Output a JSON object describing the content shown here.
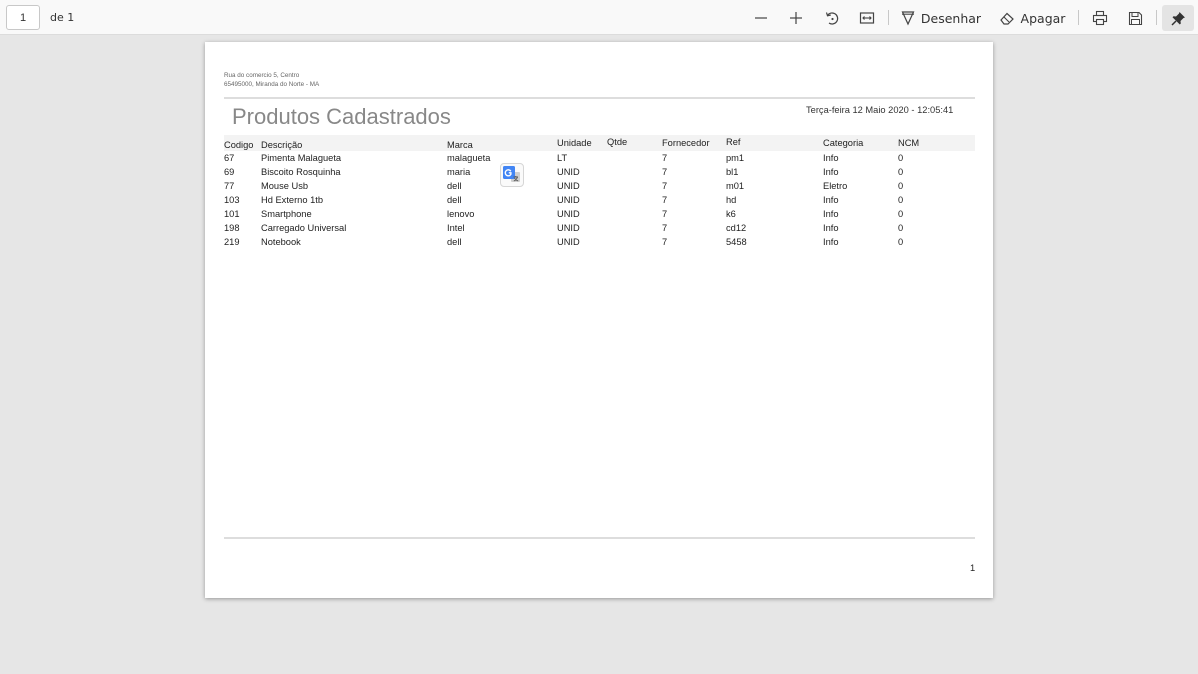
{
  "toolbar": {
    "page_value": "1",
    "page_of": "de 1",
    "draw_label": "Desenhar",
    "erase_label": "Apagar"
  },
  "icons": {
    "zoom_out": "minus-icon",
    "zoom_in": "plus-icon",
    "rotate": "rotate-icon",
    "fit": "fit-width-icon",
    "draw": "pen-icon",
    "erase": "eraser-icon",
    "print": "printer-icon",
    "save": "floppy-icon",
    "pin": "pin-icon",
    "translate": "google-translate-icon"
  },
  "document": {
    "address_lines": [
      "Rua do comercio  5,  Centro",
      "65495000,  Miranda do Norte - MA"
    ],
    "title": "Produtos Cadastrados",
    "date": "Terça-feira 12 Maio 2020 - 12:05:41",
    "columns": [
      "Codigo",
      "Descrição",
      "Marca",
      "Unidade",
      "Qtde",
      "Fornecedor",
      "Ref",
      "Categoria",
      "NCM"
    ],
    "rows": [
      [
        "67",
        "Pimenta Malagueta",
        "malagueta",
        "LT",
        "",
        "7",
        "pm1",
        "Info",
        "0"
      ],
      [
        "69",
        "Biscoito Rosquinha",
        "maria",
        "UNID",
        "",
        "7",
        "bl1",
        "Info",
        "0"
      ],
      [
        "77",
        "Mouse Usb",
        "dell",
        "UNID",
        "",
        "7",
        "m01",
        "Eletro",
        "0"
      ],
      [
        "103",
        "Hd Externo 1tb",
        "dell",
        "UNID",
        "",
        "7",
        "hd",
        "Info",
        "0"
      ],
      [
        "101",
        "Smartphone",
        "lenovo",
        "UNID",
        "",
        "7",
        "k6",
        "Info",
        "0"
      ],
      [
        "198",
        "Carregado Universal",
        "Intel",
        "UNID",
        "",
        "7",
        "cd12",
        "Info",
        "0"
      ],
      [
        "219",
        "Notebook",
        "dell",
        "UNID",
        "",
        "7",
        "5458",
        "Info",
        "0"
      ]
    ],
    "page_number": "1"
  },
  "colors": {
    "app_background": "#e6e6e6",
    "toolbar_background": "#f9f9f9",
    "title_gray": "#888888",
    "translate_blue": "#4285f4"
  }
}
